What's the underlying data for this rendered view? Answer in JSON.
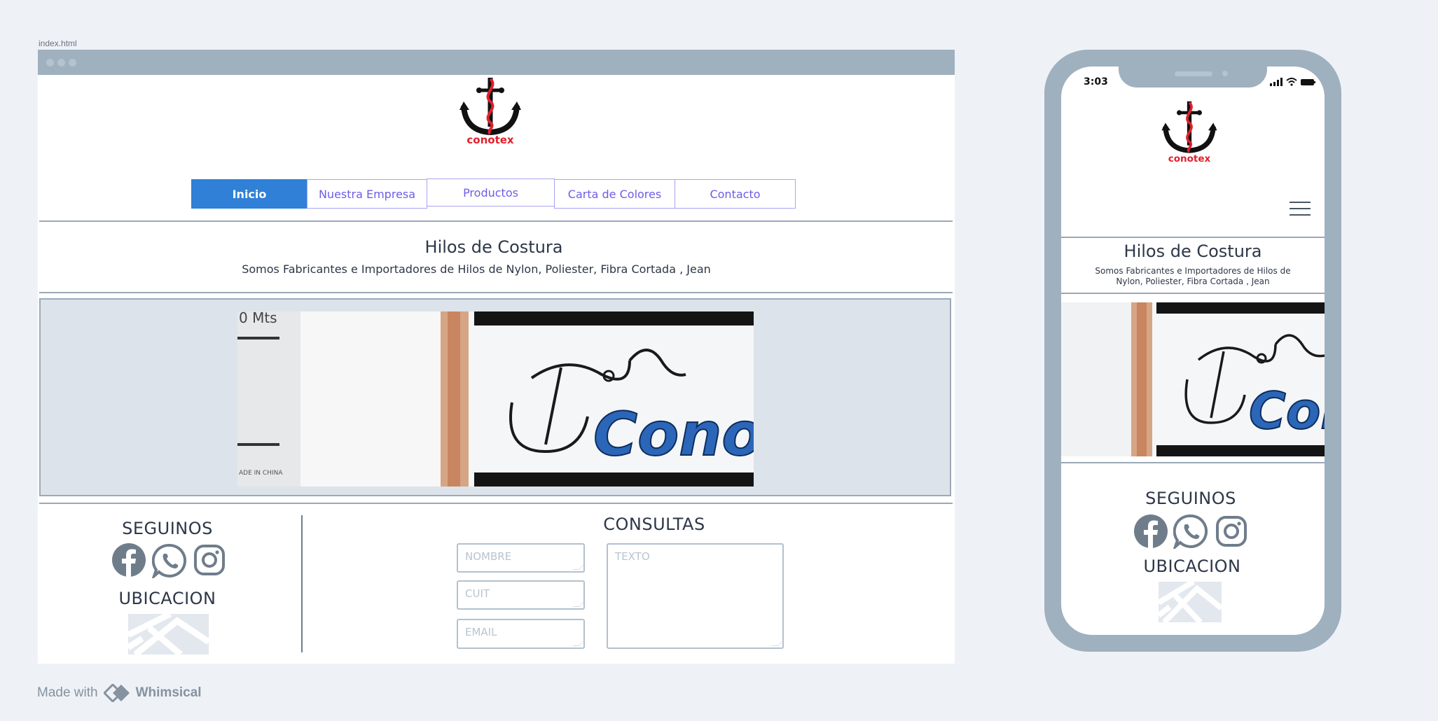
{
  "file_label": "index.html",
  "brand": {
    "name": "conotex",
    "brand_red": "#e0202c",
    "accent_blue": "#2f80d6",
    "nav_purple": "#6d5ce8"
  },
  "nav": {
    "items": [
      {
        "label": "Inicio",
        "active": true
      },
      {
        "label": "Nuestra Empresa",
        "active": false
      },
      {
        "label": "Productos",
        "active": false
      },
      {
        "label": "Carta de Colores",
        "active": false
      },
      {
        "label": "Contacto",
        "active": false
      }
    ]
  },
  "hero": {
    "title": "Hilos de Costura",
    "subtitle": "Somos Fabricantes e Importadores de Hilos de Nylon, Poliester, Fibra Cortada , Jean",
    "image_text": {
      "tag_text": "0 Mts",
      "made_in": "ADE IN CHINA",
      "brand_text": "Conotex"
    }
  },
  "footer": {
    "seguinos_label": "SEGUINOS",
    "ubicacion_label": "UBICACION",
    "consultas_label": "CONSULTAS",
    "social_icons": [
      "facebook-icon",
      "whatsapp-icon",
      "instagram-icon"
    ],
    "form": {
      "nombre_placeholder": "NOMBRE",
      "cuit_placeholder": "CUIT",
      "email_placeholder": "EMAIL",
      "texto_placeholder": "TEXTO"
    }
  },
  "phone": {
    "time": "3:03",
    "title": "Hilos de Costura",
    "subtitle": "Somos Fabricantes e Importadores de Hilos de Nylon, Poliester, Fibra Cortada , Jean",
    "seguinos_label": "SEGUINOS",
    "ubicacion_label": "UBICACION",
    "menu_icon": "hamburger-icon"
  },
  "made_with": {
    "prefix": "Made with",
    "product": "Whimsical"
  }
}
